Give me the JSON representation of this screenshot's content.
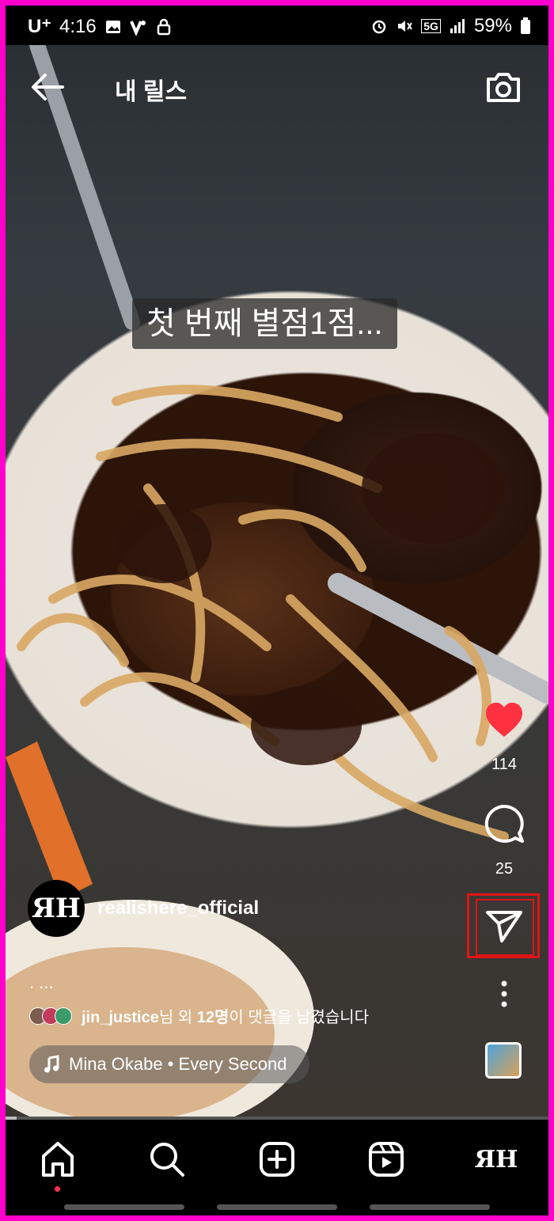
{
  "status_bar": {
    "carrier": "U⁺",
    "time": "4:16",
    "network": "5G",
    "battery": "59%"
  },
  "header": {
    "title": "내 릴스"
  },
  "video_caption": "첫 번째 별점1점...",
  "actions": {
    "like_count": "114",
    "comment_count": "25"
  },
  "post": {
    "username": "realishere_official",
    "avatar_text": "ЯH",
    "caption": ". ...",
    "comment_summary_user": "jin_justice",
    "comment_summary_mid": "님 외 ",
    "comment_summary_count": "12명",
    "comment_summary_tail": "이 댓글을 남겼습니다",
    "music": "Mina Okabe • Every Second"
  },
  "progress": 0.02,
  "nav": {
    "profile_text": "ЯH"
  },
  "colors": {
    "frame": "#ff00cc",
    "like": "#ff3040",
    "highlight": "#e01414"
  }
}
